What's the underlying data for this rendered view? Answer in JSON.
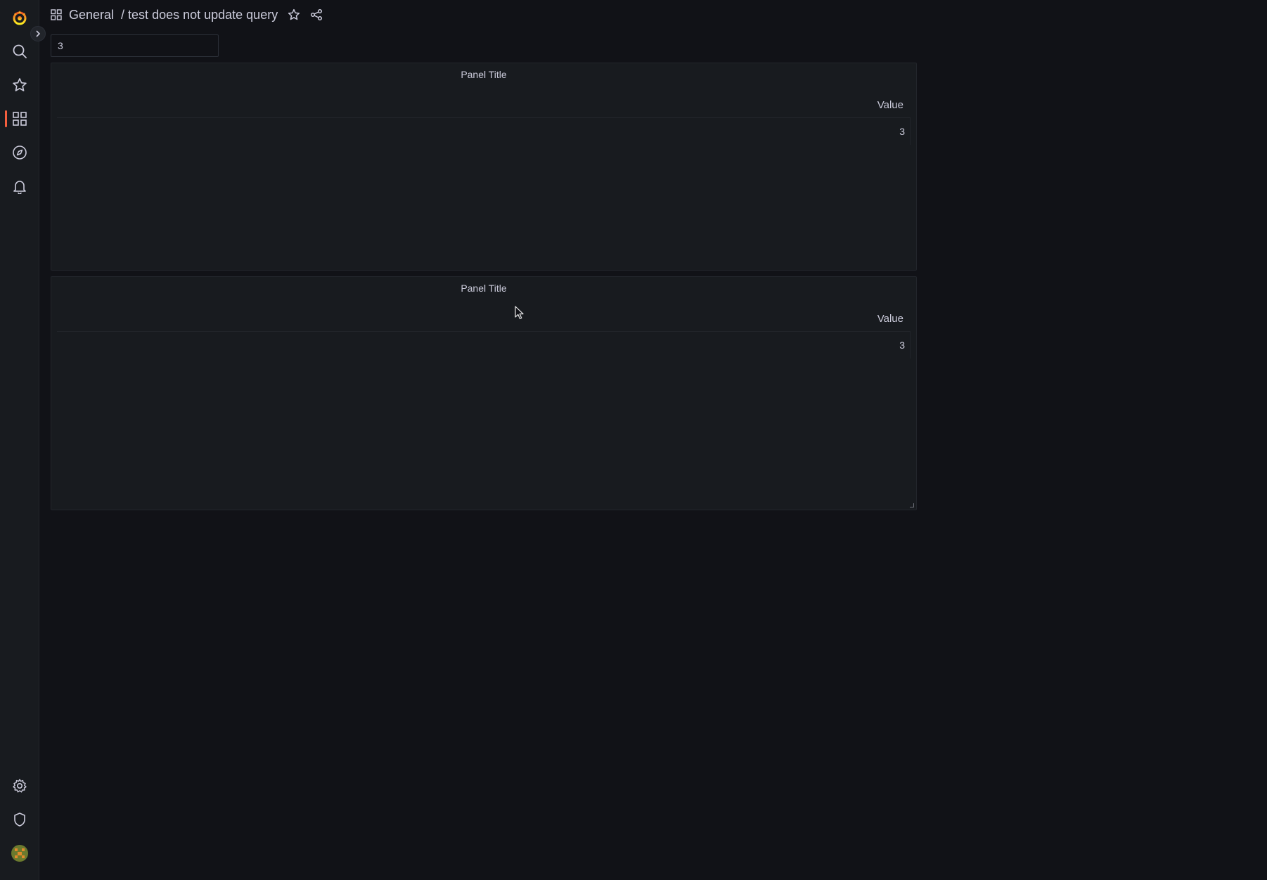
{
  "app": {
    "accent_color": "#f55f3e"
  },
  "sidenav": {
    "top_items": [
      {
        "name": "grafana-logo-icon"
      },
      {
        "name": "search-icon"
      },
      {
        "name": "starred-icon"
      },
      {
        "name": "dashboards-icon",
        "active": true
      },
      {
        "name": "explore-icon"
      },
      {
        "name": "alerting-icon"
      }
    ],
    "bottom_items": [
      {
        "name": "gear-icon"
      },
      {
        "name": "shield-icon"
      },
      {
        "name": "avatar"
      }
    ]
  },
  "breadcrumb": {
    "folder": "General",
    "title": "/ test does not update query"
  },
  "variable": {
    "value": "3"
  },
  "panels": [
    {
      "title": "Panel Title",
      "column_header": "Value",
      "rows": [
        "3"
      ]
    },
    {
      "title": "Panel Title",
      "column_header": "Value",
      "rows": [
        "3"
      ]
    }
  ]
}
